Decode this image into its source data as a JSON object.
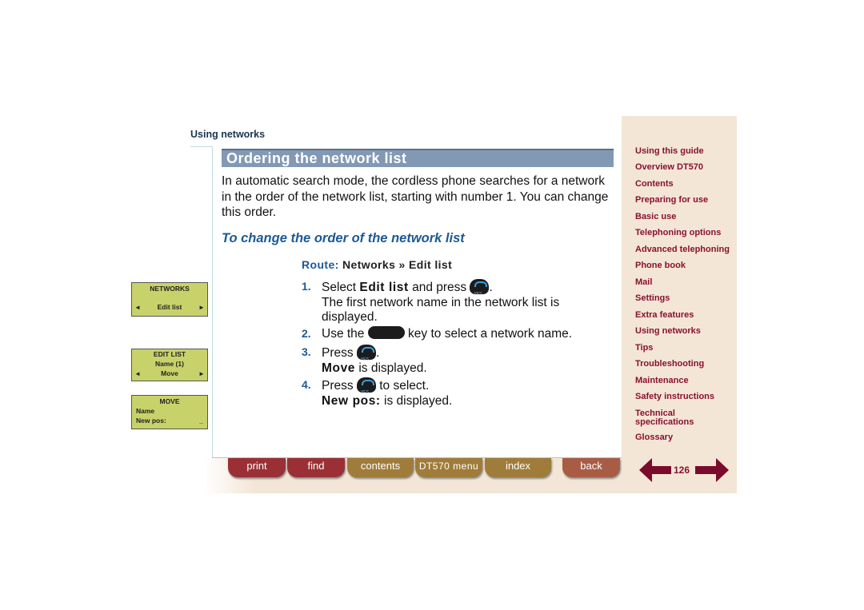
{
  "section": "Using networks",
  "title": "Ordering the network list",
  "intro": "In automatic search mode, the cordless phone searches for a network in the order of the network list, starting with number 1. You can change this order.",
  "subheading": "To change the order of the network list",
  "route": {
    "label": "Route:",
    "path": "Networks » Edit list"
  },
  "steps": [
    {
      "num": "1.",
      "a": "Select ",
      "b": "Edit list",
      "c": " and press ",
      "d": ".",
      "e": "The first network name in the network list is displayed."
    },
    {
      "num": "2.",
      "a": "Use the ",
      "c": " key to select a network name."
    },
    {
      "num": "3.",
      "a": "Press ",
      "d": ".",
      "b": "Move",
      "e": " is displayed."
    },
    {
      "num": "4.",
      "a": "Press ",
      "c": " to select.",
      "b": "New pos:",
      "e": " is displayed."
    }
  ],
  "lcd": [
    {
      "title": "NETWORKS",
      "line": "Edit list"
    },
    {
      "title": "EDIT LIST",
      "line1": "Name   (1)",
      "line": "Move"
    },
    {
      "title": "MOVE",
      "line1": "Name",
      "line2": "New  pos:",
      "cursor": "_"
    }
  ],
  "sidebar": [
    "Using this guide",
    "Overview DT570",
    "Contents",
    "Preparing for use",
    "Basic use",
    "Telephoning options",
    "Advanced telephoning",
    "Phone book",
    "Mail",
    "Settings",
    "Extra features",
    "Using networks",
    "Tips",
    "Troubleshooting",
    "Maintenance",
    "Safety instructions",
    "Technical specifications",
    "Glossary"
  ],
  "toolbar": {
    "print": "print",
    "find": "find",
    "contents": "contents",
    "menu": "DT570 menu",
    "index": "index",
    "back": "back"
  },
  "page": "126",
  "colors": {
    "title_bar": "#8199b4",
    "link": "#8a1030",
    "accent": "#1b5a96",
    "lcd": "#c8d26a",
    "sidebar": "#f3e6d6"
  }
}
